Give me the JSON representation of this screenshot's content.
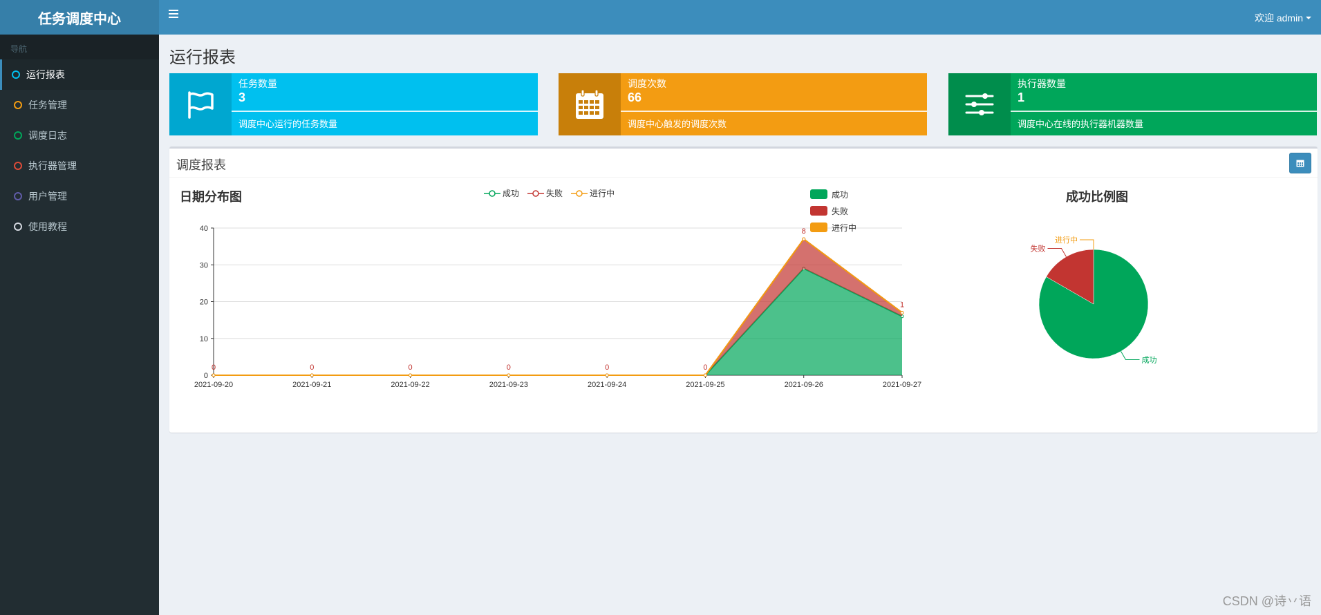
{
  "app": {
    "title": "任务调度中心",
    "welcome": "欢迎 admin"
  },
  "sidebar": {
    "header": "导航",
    "items": [
      {
        "label": "运行报表",
        "color": "#00c0ef",
        "active": true
      },
      {
        "label": "任务管理",
        "color": "#f39c12"
      },
      {
        "label": "调度日志",
        "color": "#00a65a"
      },
      {
        "label": "执行器管理",
        "color": "#dd4b39"
      },
      {
        "label": "用户管理",
        "color": "#605ca8"
      },
      {
        "label": "使用教程",
        "color": "#d2d6de"
      }
    ]
  },
  "page": {
    "title": "运行报表"
  },
  "stats": [
    {
      "label": "任务数量",
      "value": "3",
      "desc": "调度中心运行的任务数量",
      "color": "#00c0ef",
      "icon_bg": "#00a7d0",
      "icon": "flag-icon"
    },
    {
      "label": "调度次数",
      "value": "66",
      "desc": "调度中心触发的调度次数",
      "color": "#f39c12",
      "icon_bg": "#c87f0a",
      "icon": "calendar-icon"
    },
    {
      "label": "执行器数量",
      "value": "1",
      "desc": "调度中心在线的执行器机器数量",
      "color": "#00a65a",
      "icon_bg": "#008d4c",
      "icon": "sliders-icon"
    }
  ],
  "report": {
    "title": "调度报表"
  },
  "line_chart": {
    "title": "日期分布图"
  },
  "pie_chart": {
    "title": "成功比例图"
  },
  "watermark": "CSDN @诗丷语",
  "chart_data": [
    {
      "type": "area",
      "title": "日期分布图",
      "categories": [
        "2021-09-20",
        "2021-09-21",
        "2021-09-22",
        "2021-09-23",
        "2021-09-24",
        "2021-09-25",
        "2021-09-26",
        "2021-09-27"
      ],
      "stacked": true,
      "ylim": [
        0,
        40
      ],
      "yticks": [
        0,
        10,
        20,
        30,
        40
      ],
      "grid": true,
      "legend": "top",
      "series": [
        {
          "name": "成功",
          "color": "#00a65a",
          "values": [
            0,
            0,
            0,
            0,
            0,
            0,
            29,
            16
          ]
        },
        {
          "name": "失败",
          "color": "#c23531",
          "values": [
            0,
            0,
            0,
            0,
            0,
            0,
            8,
            1
          ]
        },
        {
          "name": "进行中",
          "color": "#f39c12",
          "values": [
            0,
            0,
            0,
            0,
            0,
            0,
            0,
            0
          ]
        }
      ],
      "data_labels": [
        "0",
        "0",
        "0",
        "0",
        "0",
        "0",
        "8",
        "1"
      ]
    },
    {
      "type": "pie",
      "title": "成功比例图",
      "legend": "left",
      "slices": [
        {
          "name": "成功",
          "value": 45,
          "color": "#00a65a"
        },
        {
          "name": "失败",
          "value": 9,
          "color": "#c23531"
        },
        {
          "name": "进行中",
          "value": 0,
          "color": "#f39c12"
        }
      ]
    }
  ]
}
